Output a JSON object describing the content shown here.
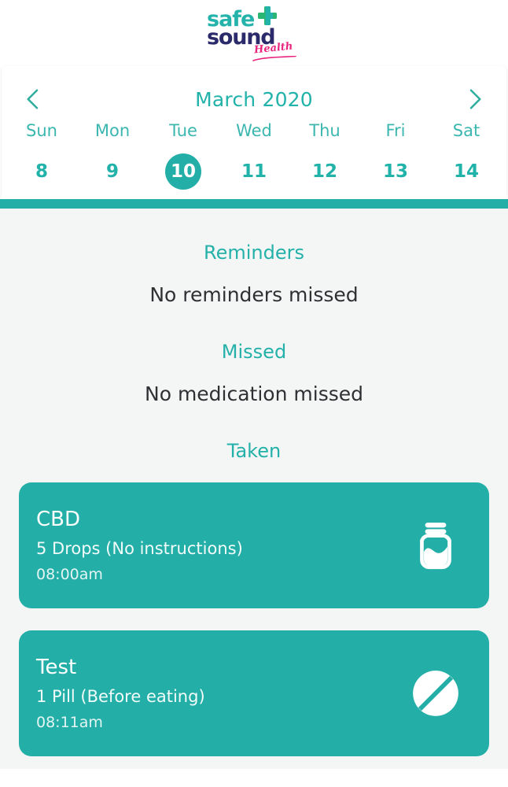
{
  "app": {
    "logo": {
      "word_one": "safe",
      "word_two": "sound",
      "tagline": "Health",
      "cross_icon": "medical-cross-icon",
      "color_teal": "#24b3aa",
      "color_navy": "#2b2a6b",
      "color_pink": "#e8257e"
    }
  },
  "calendar": {
    "prev_icon": "chevron-left-icon",
    "next_icon": "chevron-right-icon",
    "month_label": "March 2020",
    "accent_color": "#23afa7",
    "selected_index": 2,
    "days": [
      {
        "name": "Sun",
        "num": "8"
      },
      {
        "name": "Mon",
        "num": "9"
      },
      {
        "name": "Tue",
        "num": "10"
      },
      {
        "name": "Wed",
        "num": "11"
      },
      {
        "name": "Thu",
        "num": "12"
      },
      {
        "name": "Fri",
        "num": "13"
      },
      {
        "name": "Sat",
        "num": "14"
      }
    ]
  },
  "sections": {
    "reminders": {
      "heading": "Reminders",
      "empty_text": "No reminders missed"
    },
    "missed": {
      "heading": "Missed",
      "empty_text": "No medication missed"
    },
    "taken": {
      "heading": "Taken"
    }
  },
  "medications": [
    {
      "name": "CBD",
      "dose": "5 Drops (No instructions)",
      "time": "08:00am",
      "icon": "medicine-jar-icon"
    },
    {
      "name": "Test",
      "dose": "1 Pill (Before eating)",
      "time": "08:11am",
      "icon": "pill-tablet-icon"
    }
  ],
  "colors": {
    "card_teal": "#23afa7",
    "page_bg": "#f4f5f5",
    "heading_teal": "#23b1a9",
    "body_text": "#2f3033"
  }
}
